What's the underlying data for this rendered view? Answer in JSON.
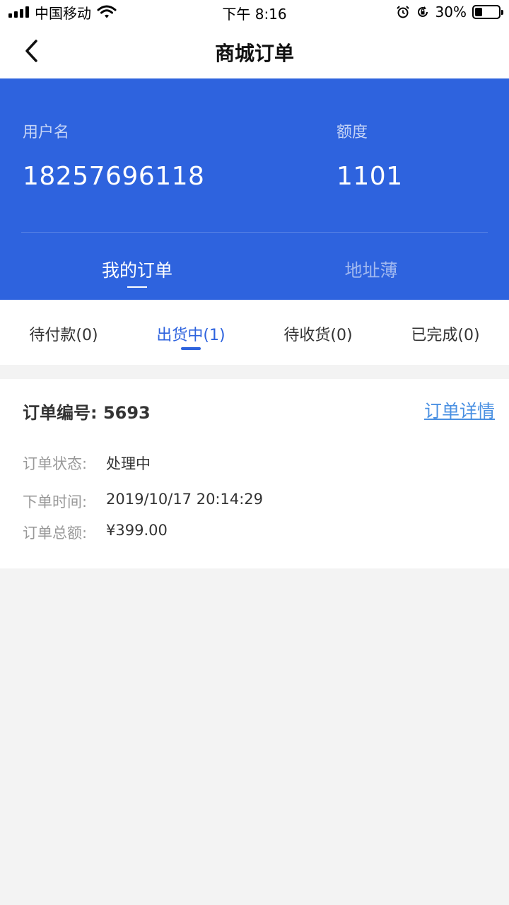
{
  "status_bar": {
    "carrier": "中国移动",
    "time": "下午 8:16",
    "battery_percent_label": "30%",
    "battery_level": 0.3
  },
  "navbar": {
    "title": "商城订单",
    "back_icon": "chevron-left-icon"
  },
  "account": {
    "username_label": "用户名",
    "username_value": "18257696118",
    "quota_label": "额度",
    "quota_value": "1101"
  },
  "main_tabs": [
    {
      "label": "我的订单",
      "active": true
    },
    {
      "label": "地址薄",
      "active": false
    }
  ],
  "order_tabs": [
    {
      "label": "待付款(0)",
      "active": false
    },
    {
      "label": "出货中(1)",
      "active": true
    },
    {
      "label": "待收货(0)",
      "active": false
    },
    {
      "label": "已完成(0)",
      "active": false
    }
  ],
  "order": {
    "number_text": "订单编号: 5693",
    "detail_link": "订单详情",
    "status_label": "订单状态:",
    "status_value": "处理中",
    "time_label": "下单时间:",
    "time_value": "2019/10/17 20:14:29",
    "total_label": "订单总额:",
    "total_value": "¥399.00"
  },
  "colors": {
    "brand_blue": "#2e63de",
    "link_blue": "#4a90e2",
    "page_bg": "#f3f3f3"
  }
}
